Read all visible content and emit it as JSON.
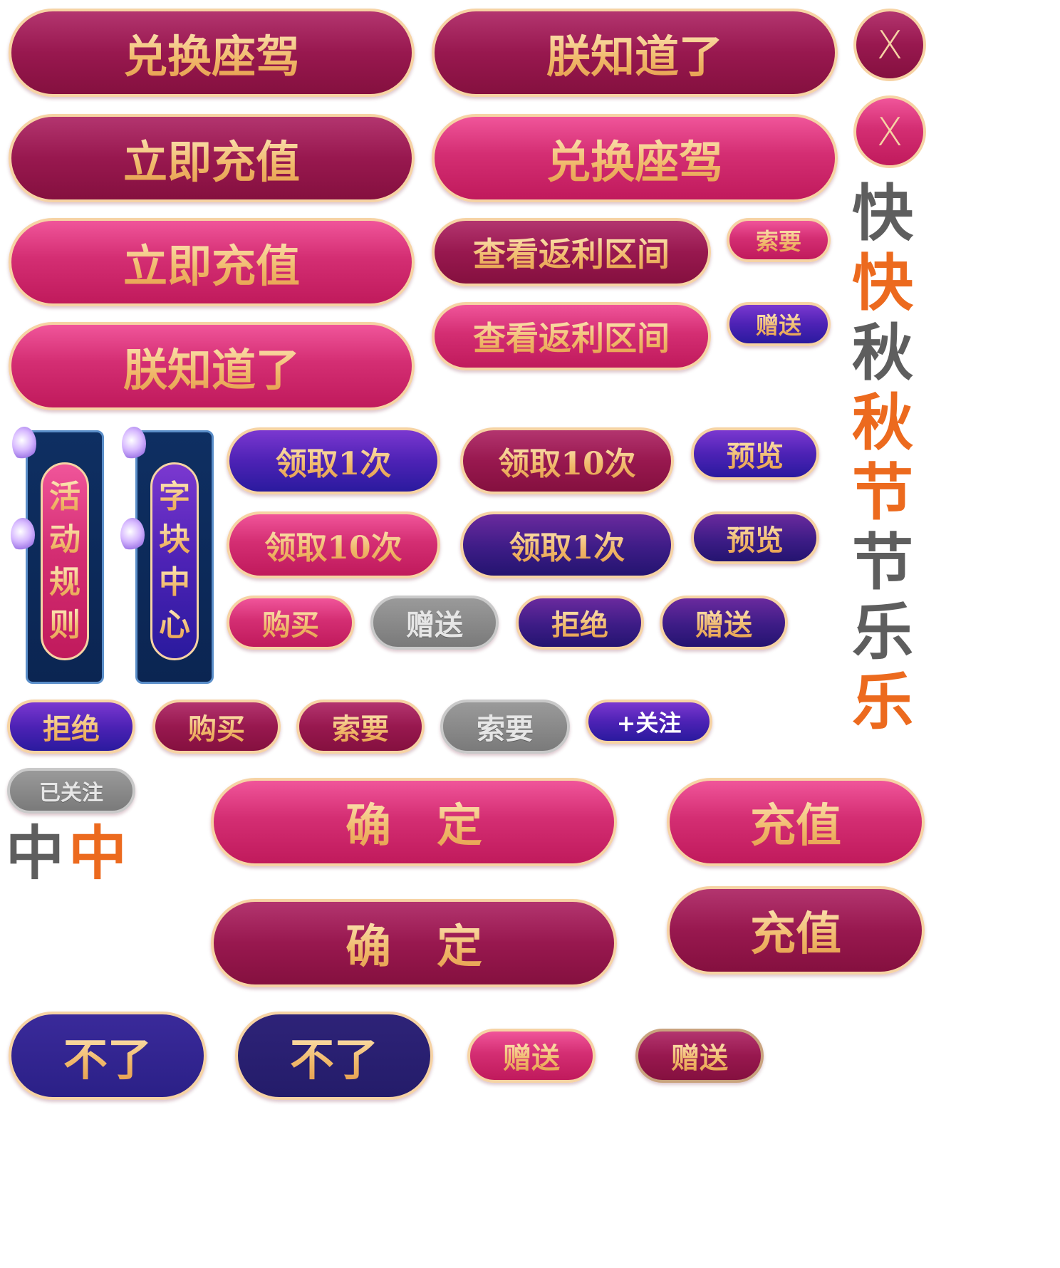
{
  "row1": {
    "exchange_ride_dark": "兑换座驾",
    "got_it_dark": "朕知道了",
    "close_1": "X"
  },
  "row2": {
    "recharge_dark": "立即充值",
    "exchange_ride_light": "兑换座驾",
    "close_2": "X"
  },
  "row3": {
    "recharge_light": "立即充值",
    "rebate_dark": "查看返利区间",
    "ask_small_pink": "索要"
  },
  "row4": {
    "got_it_light": "朕知道了",
    "rebate_light": "查看返利区间",
    "gift_small_purple": "赠送"
  },
  "banners": {
    "rules": [
      "活",
      "动",
      "规",
      "则"
    ],
    "block_center": [
      "字",
      "块",
      "中",
      "心"
    ]
  },
  "grid1": {
    "claim1_purple": "领取1次",
    "claim10_dark": "领取10次",
    "preview_purple": "预览",
    "claim10_pink": "领取10次",
    "claim1_purple_dark": "领取1次",
    "preview_purple_dark": "预览",
    "buy_pink": "购买",
    "gift_grey": "赠送",
    "refuse_purple": "拒绝",
    "gift_purple": "赠送"
  },
  "row_small": {
    "refuse_light": "拒绝",
    "buy_dark": "购买",
    "ask_dark": "索要",
    "ask_grey": "索要",
    "follow": "+关注"
  },
  "followed": "已关注",
  "mid_chars": {
    "grey": "中",
    "orange": "中"
  },
  "confirm": {
    "light": "确　定",
    "dark": "确　定"
  },
  "charge": {
    "light": "充值",
    "dark": "充值"
  },
  "bottom": {
    "no_light": "不了",
    "no_dark": "不了",
    "gift_pink": "赠送",
    "gift_dark": "赠送"
  },
  "callig_column": [
    {
      "char": "快",
      "color": "grey"
    },
    {
      "char": "快",
      "color": "orange"
    },
    {
      "char": "秋",
      "color": "grey"
    },
    {
      "char": "秋",
      "color": "orange"
    },
    {
      "char": "节",
      "color": "orange"
    },
    {
      "char": "节",
      "color": "grey"
    },
    {
      "char": "乐",
      "color": "grey"
    },
    {
      "char": "乐",
      "color": "orange"
    }
  ],
  "colors": {
    "pink_light": "#d42e73",
    "pink_dark": "#98184f",
    "purple": "#4d22b5",
    "navy": "#2b2087",
    "gold_border": "#f6d3a4",
    "gold_text": "#f1c07a",
    "grey_text": "#5e5e5e",
    "orange_text": "#ec6a1e"
  }
}
